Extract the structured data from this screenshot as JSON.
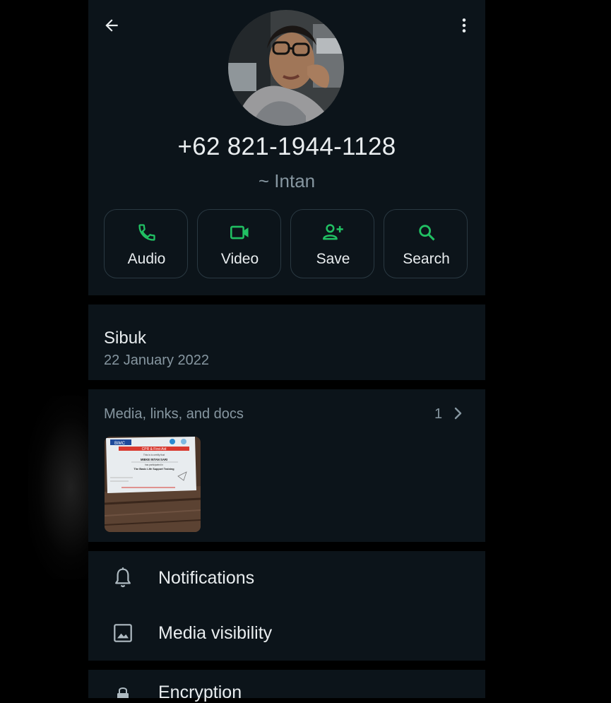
{
  "contact": {
    "phone": "+62 821-1944-1128",
    "push_name": "~ Intan"
  },
  "actions": [
    {
      "label": "Audio",
      "icon": "phone-icon"
    },
    {
      "label": "Video",
      "icon": "video-icon"
    },
    {
      "label": "Save",
      "icon": "add-contact-icon"
    },
    {
      "label": "Search",
      "icon": "search-icon"
    }
  ],
  "about": {
    "text": "Sibuk",
    "date": "22 January 2022"
  },
  "media": {
    "title": "Media, links, and docs",
    "count": "1",
    "thumbnail": {
      "brand": "BIMC",
      "heading": "CPR & First Aid",
      "line1": "This is to certify that",
      "name": "MIEKE INTAN SARI",
      "line2": "has participated in",
      "course": "The Basic Life Support Training"
    }
  },
  "settings": [
    {
      "label": "Notifications",
      "icon": "bell-icon"
    },
    {
      "label": "Media visibility",
      "icon": "image-icon"
    }
  ],
  "encryption": {
    "label": "Encryption",
    "icon": "lock-icon"
  },
  "colors": {
    "accent": "#21c063",
    "panel": "#0c141a",
    "background": "#000000",
    "text_primary": "#e9edef",
    "text_secondary": "#8696a0"
  }
}
